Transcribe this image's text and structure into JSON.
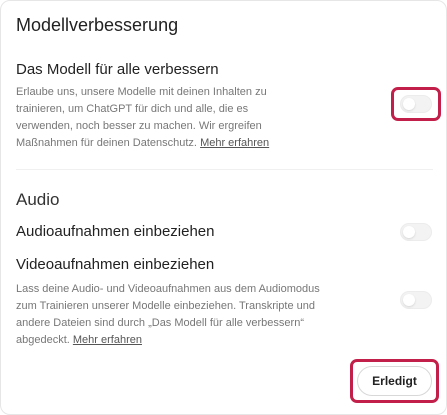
{
  "dialog": {
    "title": "Modellverbesserung",
    "improve_model": {
      "label": "Das Modell für alle verbessern",
      "description": "Erlaube uns, unsere Modelle mit deinen Inhalten zu trainieren, um ChatGPT für dich und alle, die es verwenden, noch besser zu machen. Wir ergreifen Maßnahmen für deinen Datenschutz.",
      "learn_more": "Mehr erfahren",
      "enabled": false
    },
    "audio": {
      "section_title": "Audio",
      "audio_recordings": {
        "label": "Audioaufnahmen einbeziehen",
        "enabled": false
      },
      "video_recordings": {
        "label": "Videoaufnahmen einbeziehen",
        "description": "Lass deine Audio- und Videoaufnahmen aus dem Audiomodus zum Trainieren unserer Modelle einbeziehen. Transkripte und andere Dateien sind durch „Das Modell für alle verbessern“ abgedeckt.",
        "learn_more": "Mehr erfahren",
        "enabled": false
      }
    },
    "done_label": "Erledigt",
    "colors": {
      "highlight": "#c2204a",
      "toggle_off": "#f3f3f3"
    }
  }
}
